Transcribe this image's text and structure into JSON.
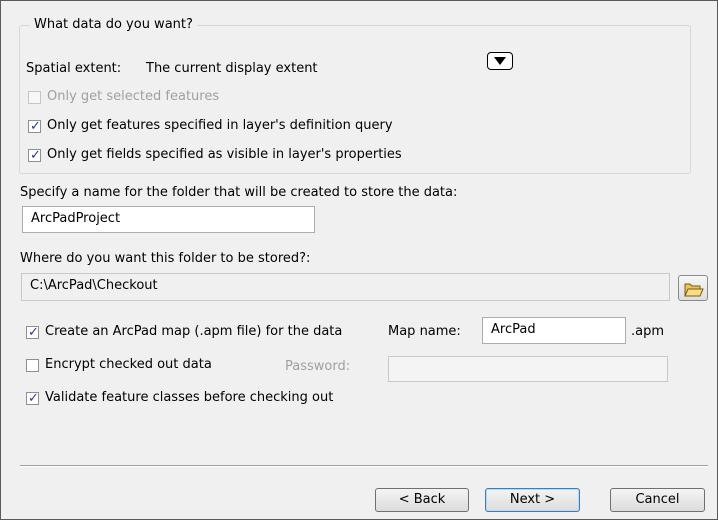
{
  "group": {
    "title": "What data do you want?",
    "spatial_extent_label": "Spatial extent:",
    "spatial_extent_value": "The current display extent",
    "options": [
      {
        "label": "Only get selected features",
        "checked": false,
        "enabled": false
      },
      {
        "label": "Only get features specified in layer's definition query",
        "checked": true,
        "enabled": true
      },
      {
        "label": "Only get fields specified as visible in layer's properties",
        "checked": true,
        "enabled": true
      }
    ]
  },
  "folder": {
    "name_label": "Specify a name for the folder that will be created to store the data:",
    "name_value": "ArcPadProject",
    "location_label": "Where do you want this folder to be stored?:",
    "location_value": "C:\\ArcPad\\Checkout"
  },
  "map": {
    "create_label": "Create an ArcPad map (.apm file) for the data",
    "create_checked": true,
    "name_label": "Map name:",
    "name_value": "ArcPad",
    "ext": ".apm"
  },
  "encrypt": {
    "label": "Encrypt checked out data",
    "checked": false,
    "password_label": "Password:",
    "password_value": ""
  },
  "validate": {
    "label": "Validate feature classes before checking out",
    "checked": true
  },
  "buttons": {
    "back": "< Back",
    "next": "Next >",
    "cancel": "Cancel"
  },
  "check_glyph": "✓",
  "icons": {
    "dropdown": "dropdown-arrow-icon",
    "browse": "open-folder-icon"
  }
}
